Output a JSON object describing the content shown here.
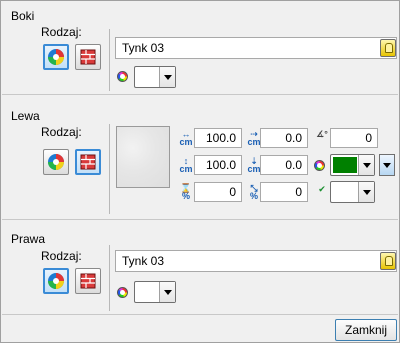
{
  "sections": {
    "boki": {
      "title": "Boki",
      "rodzaj_label": "Rodzaj:",
      "material": "Tynk 03",
      "color": "#ffffff"
    },
    "lewa": {
      "title": "Lewa",
      "rodzaj_label": "Rodzaj:",
      "width": "100.0",
      "height": "100.0",
      "offset_x": "0.0",
      "offset_y": "0.0",
      "angle": "0",
      "scale_x": "0",
      "scale_y": "0",
      "color_primary": "#008000",
      "color_secondary": "#ffffff"
    },
    "prawa": {
      "title": "Prawa",
      "rodzaj_label": "Rodzaj:",
      "material": "Tynk 03",
      "color": "#ffffff"
    }
  },
  "footer": {
    "close_label": "Zamknij"
  },
  "icons": {
    "type_material": "material-wheel-icon",
    "type_brick": "brick-icon",
    "color": "color-wheel-icon",
    "bulb": "light-bulb-icon"
  }
}
